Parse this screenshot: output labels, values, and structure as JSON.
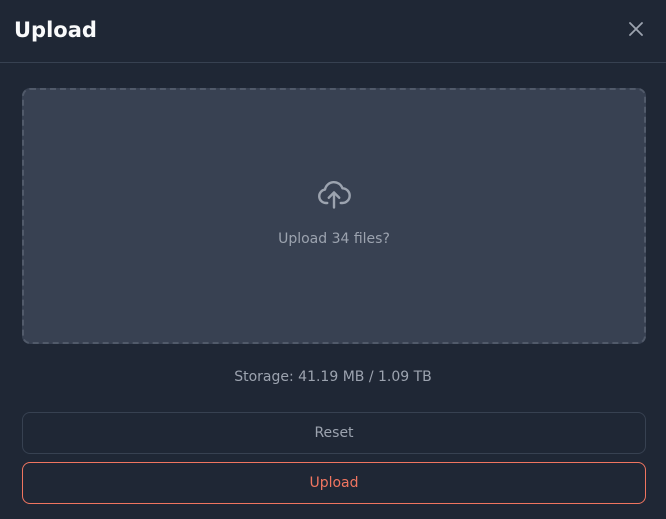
{
  "dialog": {
    "title": "Upload",
    "close_icon": "close-icon"
  },
  "dropzone": {
    "icon": "cloud-upload-icon",
    "prompt": "Upload 34 files?"
  },
  "storage": {
    "text": "Storage: 41.19 MB / 1.09 TB"
  },
  "buttons": {
    "reset_label": "Reset",
    "upload_label": "Upload"
  },
  "colors": {
    "background": "#1f2735",
    "dropzone_bg": "#384152",
    "accent": "#f07560",
    "muted_text": "#9ca3af"
  }
}
